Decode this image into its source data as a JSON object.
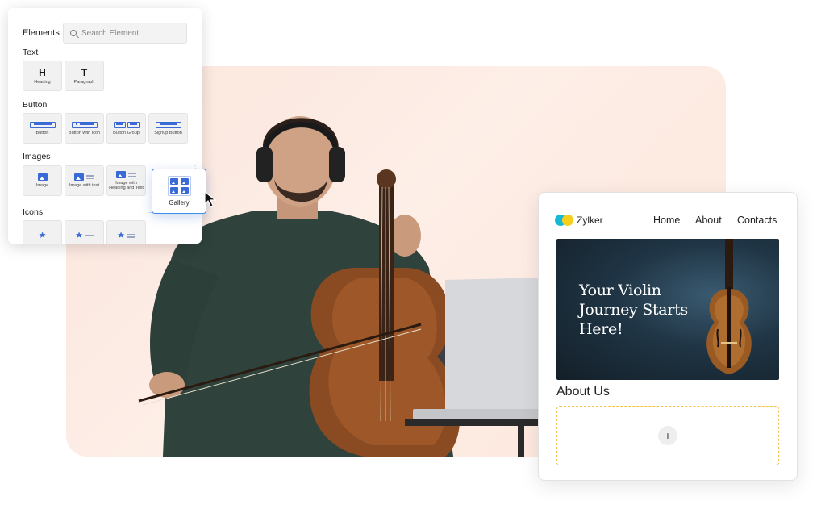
{
  "elements_panel": {
    "title": "Elements",
    "search_placeholder": "Search Element",
    "sections": {
      "text": {
        "label": "Text",
        "items": [
          {
            "glyph": "H",
            "caption": "Heading"
          },
          {
            "glyph": "T",
            "caption": "Paragraph"
          }
        ]
      },
      "button": {
        "label": "Button",
        "items": [
          {
            "caption": "Button"
          },
          {
            "caption": "Button with Icon"
          },
          {
            "caption": "Button Group"
          },
          {
            "caption": "Signup Button"
          }
        ]
      },
      "images": {
        "label": "Images",
        "items": [
          {
            "caption": "Image"
          },
          {
            "caption": "Image with text"
          },
          {
            "caption": "Image with Heading and Text"
          }
        ]
      },
      "icons": {
        "label": "Icons"
      }
    },
    "dragged_item": {
      "caption": "Gallery"
    }
  },
  "site_preview": {
    "brand": "Zylker",
    "nav": [
      "Home",
      "About",
      "Contacts"
    ],
    "hero_text": "Your Violin Journey Starts Here!",
    "section_title": "About Us",
    "add_symbol": "+"
  },
  "colors": {
    "accent": "#3a6ad6",
    "selection": "#3a8ef0",
    "background_card": "#fbe6dc",
    "logo_teal": "#17b7d6",
    "logo_yellow": "#f6cf1c",
    "dropzone_border": "#f3c24a"
  }
}
